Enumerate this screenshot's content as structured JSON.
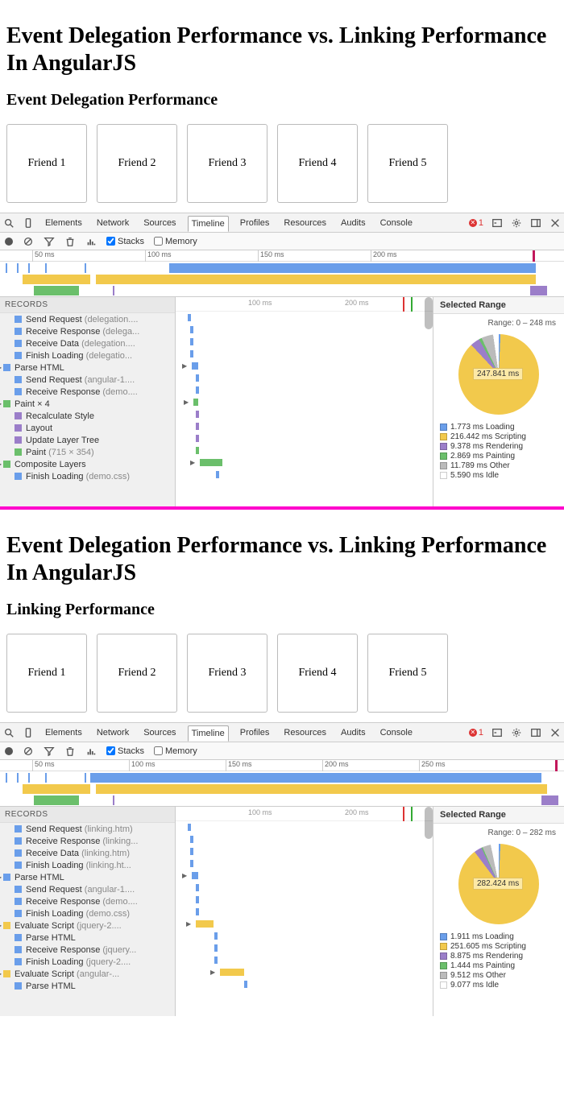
{
  "sections": [
    {
      "title": "Event Delegation Performance vs. Linking Performance In AngularJS",
      "subtitle": "Event Delegation Performance",
      "friends": [
        "Friend 1",
        "Friend 2",
        "Friend 3",
        "Friend 4",
        "Friend 5"
      ],
      "devtools": {
        "tabs": [
          "Elements",
          "Network",
          "Sources",
          "Timeline",
          "Profiles",
          "Resources",
          "Audits",
          "Console"
        ],
        "activeTab": "Timeline",
        "errorCount": "1",
        "stacksLabel": "Stacks",
        "memoryLabel": "Memory",
        "stacksChecked": true,
        "memoryChecked": false,
        "rulerTicks": [
          "50 ms",
          "100 ms",
          "150 ms",
          "200 ms"
        ],
        "recordsHeader": "RECORDS",
        "records": [
          {
            "indent": 1,
            "color": "c-load",
            "label": "Send Request",
            "sub": "(delegation....",
            "tri": false
          },
          {
            "indent": 1,
            "color": "c-load",
            "label": "Receive Response",
            "sub": "(delega...",
            "tri": false
          },
          {
            "indent": 1,
            "color": "c-load",
            "label": "Receive Data",
            "sub": "(delegation....",
            "tri": false
          },
          {
            "indent": 1,
            "color": "c-load",
            "label": "Finish Loading",
            "sub": "(delegatio...",
            "tri": false
          },
          {
            "indent": 0,
            "color": "c-load",
            "label": "Parse HTML",
            "sub": "",
            "tri": true
          },
          {
            "indent": 1,
            "color": "c-load",
            "label": "Send Request",
            "sub": "(angular-1....",
            "tri": false
          },
          {
            "indent": 1,
            "color": "c-load",
            "label": "Receive Response",
            "sub": "(demo....",
            "tri": false
          },
          {
            "indent": 0,
            "color": "c-paint",
            "label": "Paint × 4",
            "sub": "",
            "tri": true
          },
          {
            "indent": 1,
            "color": "c-render",
            "label": "Recalculate Style",
            "sub": "",
            "tri": false
          },
          {
            "indent": 1,
            "color": "c-render",
            "label": "Layout",
            "sub": "",
            "tri": false
          },
          {
            "indent": 1,
            "color": "c-render",
            "label": "Update Layer Tree",
            "sub": "",
            "tri": false
          },
          {
            "indent": 1,
            "color": "c-paint",
            "label": "Paint",
            "sub": "(715 × 354)",
            "tri": false
          },
          {
            "indent": 0,
            "color": "c-paint",
            "label": "Composite Layers",
            "sub": "",
            "tri": true
          },
          {
            "indent": 1,
            "color": "c-load",
            "label": "Finish Loading",
            "sub": "(demo.css)",
            "tri": false
          }
        ],
        "midTicks": [
          "100 ms",
          "200 ms"
        ],
        "selectedRange": "Selected Range",
        "rangeText": "Range: 0 – 248 ms",
        "pieCenter": "247.841 ms",
        "legend": [
          {
            "color": "c-load",
            "text": "1.773 ms Loading"
          },
          {
            "color": "c-script",
            "text": "216.442 ms Scripting"
          },
          {
            "color": "c-render",
            "text": "9.378 ms Rendering"
          },
          {
            "color": "c-paint",
            "text": "2.869 ms Painting"
          },
          {
            "color": "c-other",
            "text": "11.789 ms Other"
          },
          {
            "color": "c-idle",
            "text": "5.590 ms Idle"
          }
        ]
      }
    },
    {
      "title": "Event Delegation Performance vs. Linking Performance In AngularJS",
      "subtitle": "Linking Performance",
      "friends": [
        "Friend 1",
        "Friend 2",
        "Friend 3",
        "Friend 4",
        "Friend 5"
      ],
      "devtools": {
        "tabs": [
          "Elements",
          "Network",
          "Sources",
          "Timeline",
          "Profiles",
          "Resources",
          "Audits",
          "Console"
        ],
        "activeTab": "Timeline",
        "errorCount": "1",
        "stacksLabel": "Stacks",
        "memoryLabel": "Memory",
        "stacksChecked": true,
        "memoryChecked": false,
        "rulerTicks": [
          "50 ms",
          "100 ms",
          "150 ms",
          "200 ms",
          "250 ms"
        ],
        "recordsHeader": "RECORDS",
        "records": [
          {
            "indent": 1,
            "color": "c-load",
            "label": "Send Request",
            "sub": "(linking.htm)",
            "tri": false
          },
          {
            "indent": 1,
            "color": "c-load",
            "label": "Receive Response",
            "sub": "(linking...",
            "tri": false
          },
          {
            "indent": 1,
            "color": "c-load",
            "label": "Receive Data",
            "sub": "(linking.htm)",
            "tri": false
          },
          {
            "indent": 1,
            "color": "c-load",
            "label": "Finish Loading",
            "sub": "(linking.ht...",
            "tri": false
          },
          {
            "indent": 0,
            "color": "c-load",
            "label": "Parse HTML",
            "sub": "",
            "tri": true
          },
          {
            "indent": 1,
            "color": "c-load",
            "label": "Send Request",
            "sub": "(angular-1....",
            "tri": false
          },
          {
            "indent": 1,
            "color": "c-load",
            "label": "Receive Response",
            "sub": "(demo....",
            "tri": false
          },
          {
            "indent": 1,
            "color": "c-load",
            "label": "Finish Loading",
            "sub": "(demo.css)",
            "tri": false
          },
          {
            "indent": 0,
            "color": "c-script",
            "label": "Evaluate Script",
            "sub": "(jquery-2....",
            "tri": true
          },
          {
            "indent": 1,
            "color": "c-load",
            "label": "Parse HTML",
            "sub": "",
            "tri": false
          },
          {
            "indent": 1,
            "color": "c-load",
            "label": "Receive Response",
            "sub": "(jquery...",
            "tri": false
          },
          {
            "indent": 1,
            "color": "c-load",
            "label": "Finish Loading",
            "sub": "(jquery-2....",
            "tri": false
          },
          {
            "indent": 0,
            "color": "c-script",
            "label": "Evaluate Script",
            "sub": "(angular-...",
            "tri": true
          },
          {
            "indent": 1,
            "color": "c-load",
            "label": "Parse HTML",
            "sub": "",
            "tri": false
          }
        ],
        "midTicks": [
          "100 ms",
          "200 ms"
        ],
        "selectedRange": "Selected Range",
        "rangeText": "Range: 0 – 282 ms",
        "pieCenter": "282.424 ms",
        "legend": [
          {
            "color": "c-load",
            "text": "1.911 ms Loading"
          },
          {
            "color": "c-script",
            "text": "251.605 ms Scripting"
          },
          {
            "color": "c-render",
            "text": "8.875 ms Rendering"
          },
          {
            "color": "c-paint",
            "text": "1.444 ms Painting"
          },
          {
            "color": "c-other",
            "text": "9.512 ms Other"
          },
          {
            "color": "c-idle",
            "text": "9.077 ms Idle"
          }
        ]
      }
    }
  ],
  "chart_data": [
    {
      "type": "pie",
      "title": "Selected Range 0–248 ms",
      "series": [
        {
          "name": "Loading",
          "value": 1.773
        },
        {
          "name": "Scripting",
          "value": 216.442
        },
        {
          "name": "Rendering",
          "value": 9.378
        },
        {
          "name": "Painting",
          "value": 2.869
        },
        {
          "name": "Other",
          "value": 11.789
        },
        {
          "name": "Idle",
          "value": 5.59
        }
      ],
      "total_label": "247.841 ms"
    },
    {
      "type": "pie",
      "title": "Selected Range 0–282 ms",
      "series": [
        {
          "name": "Loading",
          "value": 1.911
        },
        {
          "name": "Scripting",
          "value": 251.605
        },
        {
          "name": "Rendering",
          "value": 8.875
        },
        {
          "name": "Painting",
          "value": 1.444
        },
        {
          "name": "Other",
          "value": 9.512
        },
        {
          "name": "Idle",
          "value": 9.077
        }
      ],
      "total_label": "282.424 ms"
    }
  ]
}
